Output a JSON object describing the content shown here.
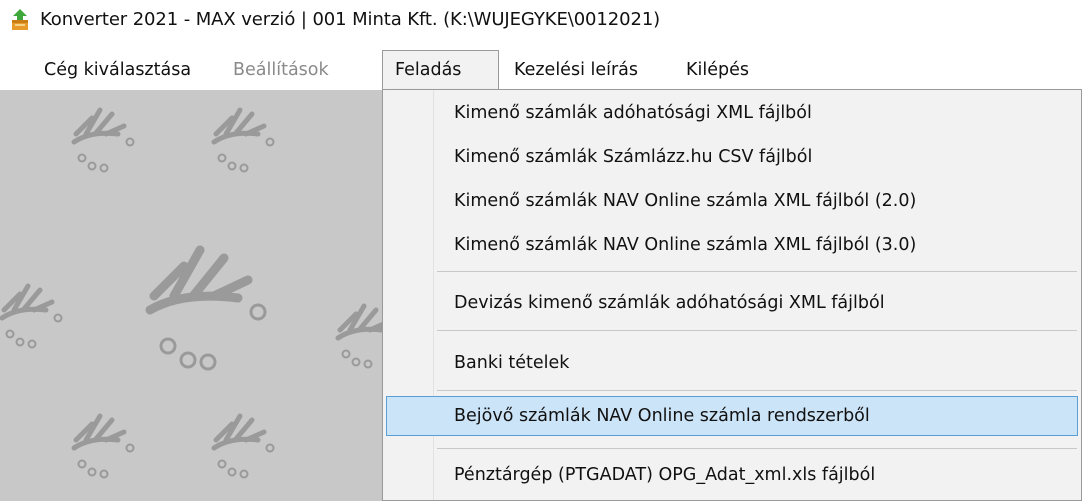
{
  "window": {
    "title": "Konverter 2021 - MAX verzió  | 001 Minta Kft. (K:\\WUJEGYKE\\0012021)"
  },
  "menubar": {
    "items": [
      {
        "label": "Cég kiválasztása",
        "state": "normal"
      },
      {
        "label": "Beállítások",
        "state": "disabled"
      },
      {
        "label": "Feladás",
        "state": "active"
      },
      {
        "label": "Kezelési leírás",
        "state": "normal"
      },
      {
        "label": "Kilépés",
        "state": "normal"
      }
    ]
  },
  "dropdown": {
    "items": [
      {
        "label": "Kimenő számlák adóhatósági XML fájlból"
      },
      {
        "label": "Kimenő számlák Számlázz.hu CSV fájlból"
      },
      {
        "label": "Kimenő számlák NAV Online számla XML fájlból (2.0)"
      },
      {
        "label": "Kimenő számlák NAV Online számla XML fájlból (3.0)"
      },
      {
        "label": "Devizás kimenő számlák adóhatósági XML fájlból"
      },
      {
        "label": "Banki tételek"
      },
      {
        "label": "Bejövő számlák NAV Online számla rendszerből",
        "highlighted": true
      },
      {
        "label": "Pénztárgép (PTGADAT) OPG_Adat_xml.xls fájlból"
      }
    ]
  },
  "colors": {
    "workspace_bg": "#c8c8c8",
    "menu_bg": "#f2f2f2",
    "highlight_bg": "#cce4f7",
    "highlight_border": "#5a9ed6",
    "disabled_text": "#8a8a8a"
  },
  "icons": {
    "app": "app-icon",
    "background_pattern": "watermark-logo-pattern"
  }
}
